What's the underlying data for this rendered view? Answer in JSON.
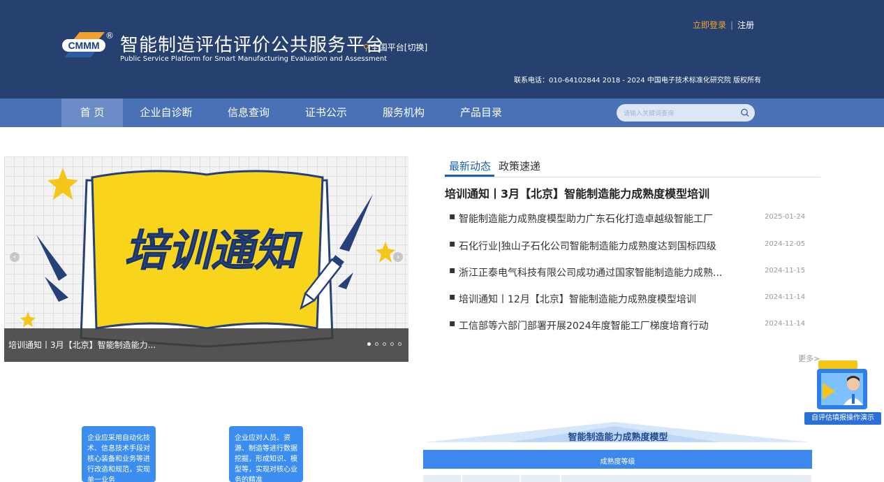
{
  "header": {
    "logo_text": "CMMM",
    "registered": "®",
    "title": "智能制造评估评价公共服务平台",
    "subtitle": "Public Service Platform for Smart Manufacturing Evaluation and Assessment",
    "platform_switch": "全国平台[切换]",
    "login": "立即登录",
    "separator": "|",
    "register": "注册",
    "contact": "联系电话：010-64102844  2018 - 2024 中国电子技术标准化研究院 版权所有"
  },
  "nav": {
    "items": [
      {
        "label": "首 页"
      },
      {
        "label": "企业自诊断"
      },
      {
        "label": "信息查询"
      },
      {
        "label": "证书公示"
      },
      {
        "label": "服务机构"
      },
      {
        "label": "产品目录"
      }
    ],
    "search_placeholder": "请输入关键词查询"
  },
  "banner": {
    "image_text": "培训通知",
    "caption": "培训通知丨3月【北京】智能制造能力...",
    "prev": "‹",
    "next": "›",
    "slide_count": 5,
    "active_slide": 1
  },
  "news": {
    "tabs": [
      {
        "label": "最新动态"
      },
      {
        "label": "政策速递"
      }
    ],
    "headline": "培训通知丨3月【北京】智能制造能力成熟度模型培训",
    "items": [
      {
        "title": "智能制造能力成熟度模型助力广东石化打造卓越级智能工厂",
        "date": "2025-01-24"
      },
      {
        "title": "石化行业|独山子石化公司智能制造能力成熟度达到国标四级",
        "date": "2024-12-05"
      },
      {
        "title": "浙江正泰电气科技有限公司成功通过国家智能制造能力成熟...",
        "date": "2024-11-15"
      },
      {
        "title": "培训通知丨12月【北京】智能制造能力成熟度模型培训",
        "date": "2024-11-14"
      },
      {
        "title": "工信部等六部门部署开展2024年度智能工厂梯度培育行动",
        "date": "2024-11-14"
      }
    ],
    "bullet": "▪",
    "more": "更多>"
  },
  "helper": {
    "label": "自评估填报操作演示"
  },
  "cards": [
    {
      "text": "企业应采用自动化技术、信息技术手段对核心装备和业务等进行改造和规范，实现单一业务"
    },
    {
      "text": "企业应对人员、资源、制造等进行数据挖掘，形成知识、模型等，实现对核心业务的精准"
    }
  ],
  "maturity": {
    "title": "智能制造能力成熟度模型",
    "bar_label": "成熟度等级"
  },
  "colors": {
    "header_bg": "#26406f",
    "nav_bg": "#4a71b5",
    "accent_orange": "#f5a623",
    "link_blue": "#1f5ea8"
  }
}
